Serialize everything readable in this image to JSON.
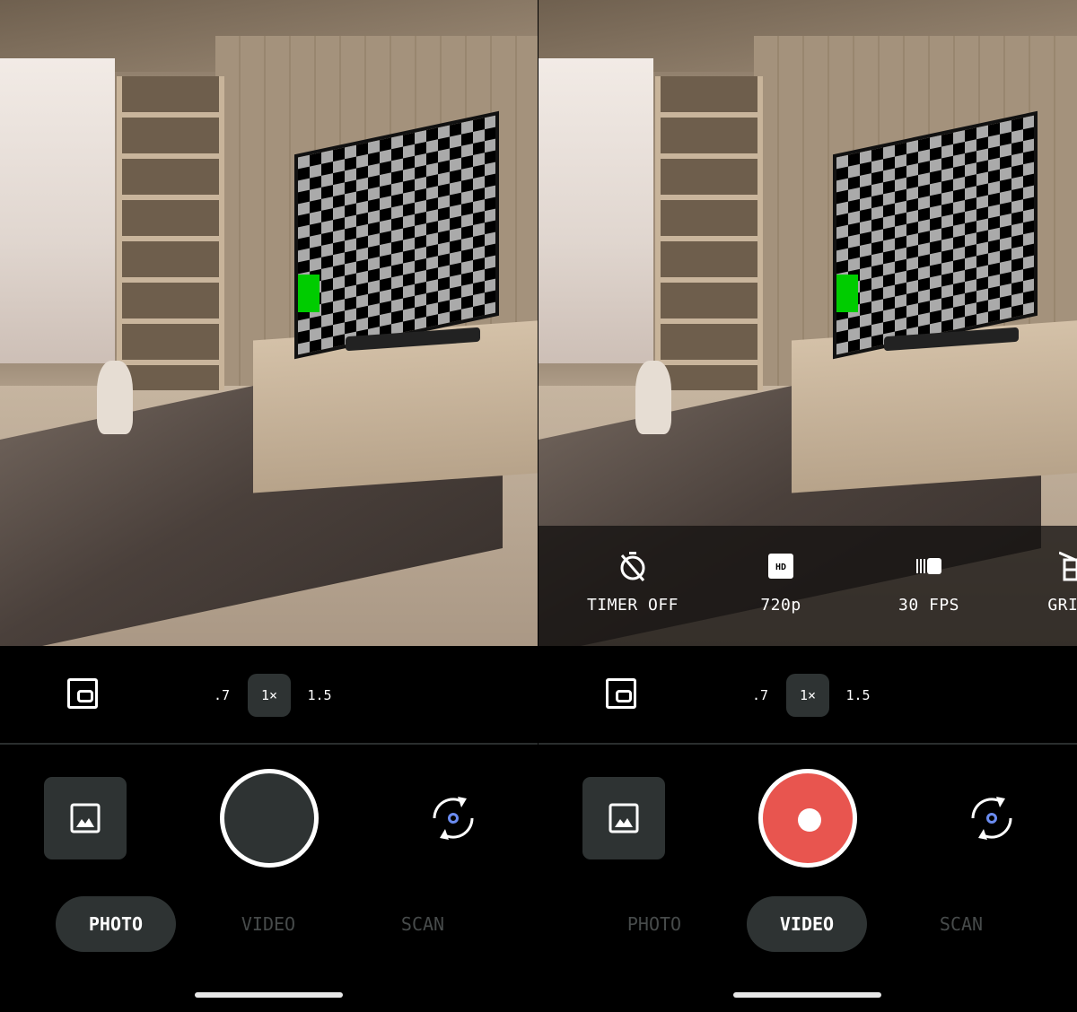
{
  "screens": [
    {
      "mode": "PHOTO",
      "zoom": {
        "options": [
          ".7",
          "1×",
          "1.5"
        ],
        "selected": "1×"
      },
      "modes": [
        "PHOTO",
        "VIDEO",
        "SCAN"
      ],
      "selected_mode": "PHOTO",
      "shutter": "photo"
    },
    {
      "mode": "VIDEO",
      "zoom": {
        "options": [
          ".7",
          "1×",
          "1.5"
        ],
        "selected": "1×"
      },
      "modes": [
        "PHOTO",
        "VIDEO",
        "SCAN"
      ],
      "selected_mode": "VIDEO",
      "shutter": "record",
      "settings": [
        {
          "icon": "timer-off-icon",
          "label": "TIMER OFF"
        },
        {
          "icon": "hd-icon",
          "label": "720p"
        },
        {
          "icon": "fps-icon",
          "label": "30 FPS"
        },
        {
          "icon": "grid-icon",
          "label": "GRID"
        }
      ]
    }
  ],
  "colors": {
    "record": "#e8554f",
    "surface": "#2e3333",
    "accent": "#6b8cf0",
    "inactive_mode": "#474b4b"
  }
}
